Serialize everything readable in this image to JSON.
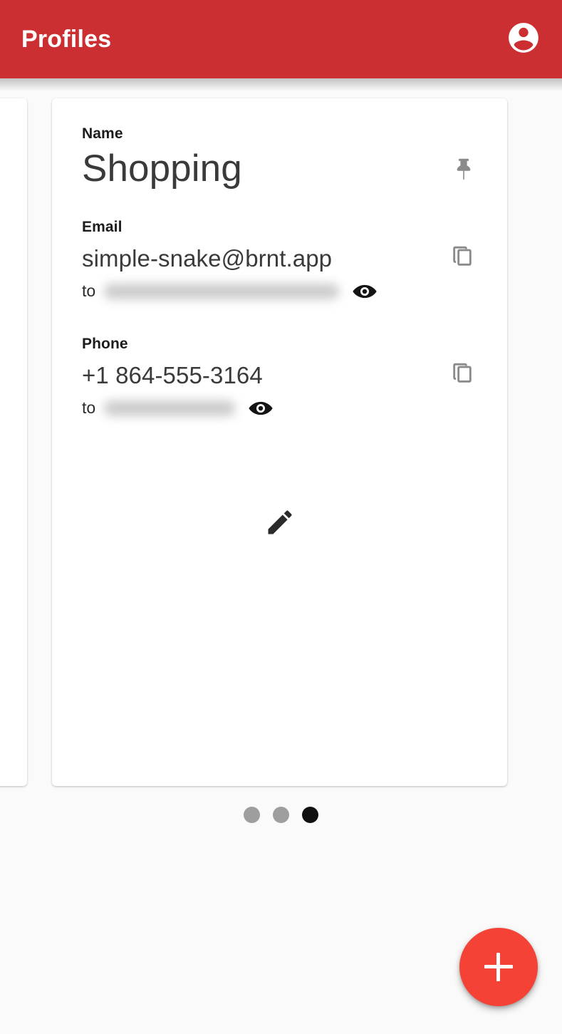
{
  "appbar": {
    "title": "Profiles",
    "account_icon": "account-circle-icon",
    "background_color": "#CC2F31",
    "title_color": "#FFFFFF"
  },
  "card": {
    "fields": [
      {
        "label": "Name",
        "value": "Shopping",
        "action_icon": "pin-icon",
        "has_forward": false
      },
      {
        "label": "Email",
        "value": "simple-snake@brnt.app",
        "action_icon": "copy-icon",
        "has_forward": true,
        "forward_prefix": "to",
        "forward_value": "",
        "forward_redacted": true,
        "forward_icon": "eye-icon"
      },
      {
        "label": "Phone",
        "value": "+1 864-555-3164",
        "action_icon": "copy-icon",
        "has_forward": true,
        "forward_prefix": "to",
        "forward_value": "",
        "forward_redacted": true,
        "forward_icon": "eye-icon"
      }
    ],
    "edit_icon": "pencil-icon"
  },
  "pager": {
    "total": 3,
    "active_index": 3,
    "active_color": "#111111",
    "inactive_color": "#9E9E9E"
  },
  "fab": {
    "icon": "plus-icon",
    "label": "+",
    "color": "#F44336"
  }
}
